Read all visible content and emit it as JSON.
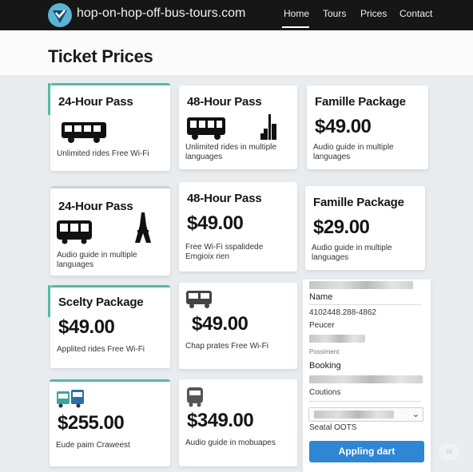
{
  "header": {
    "brand": "hop-on-hop-off-bus-tours.com",
    "logo_icon": "check-badge-icon",
    "nav": [
      "Home",
      "Tours",
      "Prices",
      "Contact"
    ],
    "active_nav": "Home"
  },
  "page": {
    "title": "Ticket Prices"
  },
  "colors": {
    "accent": "#59b8a4",
    "button": "#2e86d4",
    "nav_bg": "#161616"
  },
  "cards": [
    {
      "title": "24-Hour Pass",
      "price": "",
      "desc": "Unlimited rides Free Wi-Fi",
      "icon": "bus-icon"
    },
    {
      "title": "48-Hour Pass",
      "price": "",
      "desc": "Unlimited rides in multiple languages",
      "icon": "bus-skyline-icon"
    },
    {
      "title": "Famille Package",
      "price": "$49.00",
      "desc": "Audio guide in multiple languages",
      "icon": ""
    },
    {
      "title": "24-Hour Pass",
      "price": "",
      "desc": "Audio guide in multiple languages",
      "icon": "bus-eiffel-icon"
    },
    {
      "title": "48-Hour Pass",
      "price": "$49.00",
      "desc": "Free Wi-Fi sspalidede Emgioix rien",
      "icon": ""
    },
    {
      "title": "Famille Package",
      "price": "$29.00",
      "desc": "Audio guide in multiple languages",
      "icon": ""
    },
    {
      "title": "Scelty Package",
      "price": "$49.00",
      "desc": "Applited rides Free Wi-Fi",
      "icon": ""
    },
    {
      "title": "",
      "price": "$49.00",
      "desc": "Chap prates Free Wi-Fi",
      "icon": "bus-front-icon"
    },
    {
      "title": "",
      "price": "$255.00",
      "desc": "Eude paim Craweest",
      "icon": "bus-pair-icon"
    },
    {
      "title": "",
      "price": "$349.00",
      "desc": "Audio guide in mobuapes",
      "icon": "bus-small-icon"
    }
  ],
  "form": {
    "name_label": "Name",
    "phone_value": "4102448.288-4862",
    "peucer_label": "Peucer",
    "position_label": "Possiment",
    "booking_label": "Booking",
    "coutions_label": "Coutions",
    "seatal_label": "Seatal OOTS",
    "apply_button": "Appling dart",
    "chevron": "chevron-down-icon"
  },
  "fab_label": "oi"
}
